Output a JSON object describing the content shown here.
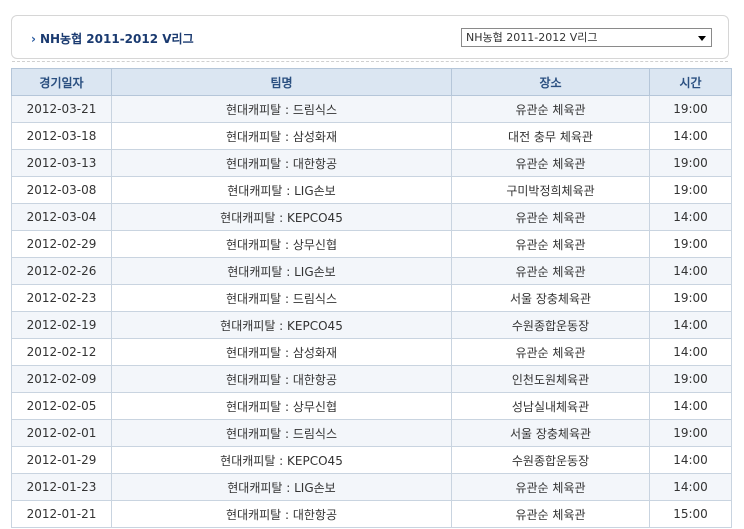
{
  "header": {
    "title": "NH농협 2011-2012 V리그",
    "title_arrow": "›",
    "select_value": "NH농협 2011-2012 V리그"
  },
  "table": {
    "columns": [
      "경기일자",
      "팀명",
      "장소",
      "시간"
    ],
    "rows": [
      {
        "date": "2012-03-21",
        "team": "현대캐피탈 : 드림식스",
        "venue": "유관순 체육관",
        "time": "19:00"
      },
      {
        "date": "2012-03-18",
        "team": "현대캐피탈 : 삼성화재",
        "venue": "대전 충무 체육관",
        "time": "14:00"
      },
      {
        "date": "2012-03-13",
        "team": "현대캐피탈 : 대한항공",
        "venue": "유관순 체육관",
        "time": "19:00"
      },
      {
        "date": "2012-03-08",
        "team": "현대캐피탈 : LIG손보",
        "venue": "구미박정희체육관",
        "time": "19:00"
      },
      {
        "date": "2012-03-04",
        "team": "현대캐피탈 : KEPCO45",
        "venue": "유관순 체육관",
        "time": "14:00"
      },
      {
        "date": "2012-02-29",
        "team": "현대캐피탈 : 상무신협",
        "venue": "유관순 체육관",
        "time": "19:00"
      },
      {
        "date": "2012-02-26",
        "team": "현대캐피탈 : LIG손보",
        "venue": "유관순 체육관",
        "time": "14:00"
      },
      {
        "date": "2012-02-23",
        "team": "현대캐피탈 : 드림식스",
        "venue": "서울 장충체육관",
        "time": "19:00"
      },
      {
        "date": "2012-02-19",
        "team": "현대캐피탈 : KEPCO45",
        "venue": "수원종합운동장",
        "time": "14:00"
      },
      {
        "date": "2012-02-12",
        "team": "현대캐피탈 : 삼성화재",
        "venue": "유관순 체육관",
        "time": "14:00"
      },
      {
        "date": "2012-02-09",
        "team": "현대캐피탈 : 대한항공",
        "venue": "인천도원체육관",
        "time": "19:00"
      },
      {
        "date": "2012-02-05",
        "team": "현대캐피탈 : 상무신협",
        "venue": "성남실내체육관",
        "time": "14:00"
      },
      {
        "date": "2012-02-01",
        "team": "현대캐피탈 : 드림식스",
        "venue": "서울 장충체육관",
        "time": "19:00"
      },
      {
        "date": "2012-01-29",
        "team": "현대캐피탈 : KEPCO45",
        "venue": "수원종합운동장",
        "time": "14:00"
      },
      {
        "date": "2012-01-23",
        "team": "현대캐피탈 : LIG손보",
        "venue": "유관순 체육관",
        "time": "14:00"
      },
      {
        "date": "2012-01-21",
        "team": "현대캐피탈 : 대한항공",
        "venue": "유관순 체육관",
        "time": "15:00"
      }
    ]
  }
}
